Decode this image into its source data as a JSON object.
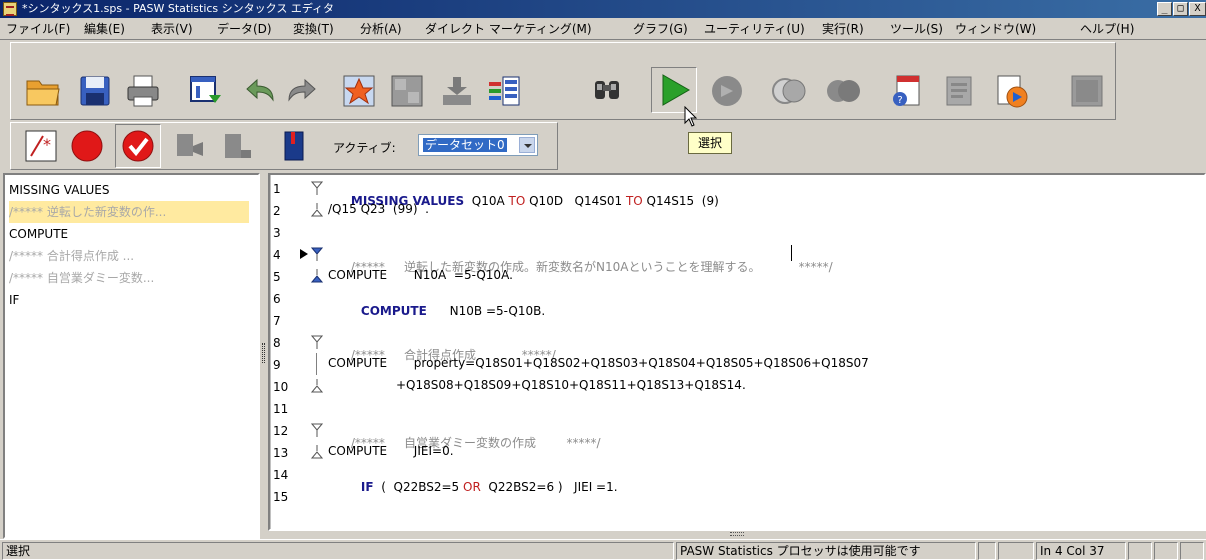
{
  "window": {
    "title": "*シンタックス1.sps - PASW Statistics シンタックス エディタ",
    "controls": [
      "_",
      "□",
      "X"
    ]
  },
  "menu": [
    "ファイル(F)",
    "編集(E)",
    "表示(V)",
    "データ(D)",
    "変換(T)",
    "分析(A)",
    "ダイレクト マーケティング(M)",
    "グラフ(G)",
    "ユーティリティ(U)",
    "実行(R)",
    "ツール(S)",
    "ウィンドウ(W)",
    "ヘルプ(H)"
  ],
  "toolbar": {
    "icons": [
      "open-folder-icon",
      "save-icon",
      "print-icon",
      "recall-dialog-icon",
      "undo-icon",
      "redo-icon",
      "go-to-case-icon",
      "go-to-variable-icon",
      "variables-icon",
      "use-variable-sets-icon",
      "find-icon",
      "run-selection-icon",
      "step-through-icon",
      "step-forward-icon",
      "continue-icon",
      "help-icon",
      "syntax-help-icon",
      "active-dataset-icon",
      "options-icon"
    ],
    "tooltip": "選択",
    "row2_icons": [
      "toggle-comment-icon",
      "breakpoint-icon",
      "clear-breakpoints-icon",
      "bookmark-icon",
      "next-bookmark-icon",
      "book-icon"
    ]
  },
  "active_dataset": {
    "label": "アクティブ:",
    "value": "データセット0"
  },
  "navigator": [
    {
      "text": "MISSING VALUES",
      "comment": false,
      "selected": false
    },
    {
      "text": "/*****   逆転した新変数の作...",
      "comment": true,
      "selected": true
    },
    {
      "text": "COMPUTE",
      "comment": false,
      "selected": false
    },
    {
      "text": "/*****   合計得点作成  ...",
      "comment": true,
      "selected": false
    },
    {
      "text": "/*****   自営業ダミー変数...",
      "comment": true,
      "selected": false
    },
    {
      "text": "IF",
      "comment": false,
      "selected": false
    }
  ],
  "editor": {
    "lines": [
      {
        "num": "1"
      },
      {
        "num": "2"
      },
      {
        "num": "3"
      },
      {
        "num": "4"
      },
      {
        "num": "5"
      },
      {
        "num": "6"
      },
      {
        "num": "7"
      },
      {
        "num": "8"
      },
      {
        "num": "9"
      },
      {
        "num": "10"
      },
      {
        "num": "11"
      },
      {
        "num": "12"
      },
      {
        "num": "13"
      },
      {
        "num": "14"
      },
      {
        "num": "15"
      }
    ],
    "code": {
      "l1_kw": "MISSING VALUES",
      "l1_a": "  Q10A ",
      "l1_to1": "TO",
      "l1_b": " Q10D   Q14S01 ",
      "l1_to2": "TO",
      "l1_c": " Q14S15  (9)",
      "l2": "/Q15 Q23  (99)  .",
      "l4_open": "/*****",
      "l4_text": "     逆転した新変数の作成。新変数名がN10Aということを理解する。",
      "l4_close": "          *****/",
      "l5": "COMPUTE       N10A  =5-Q10A.",
      "l6_kw": "COMPUTE",
      "l6_rest": "      N10B =5-Q10B.",
      "l8_open": "/*****",
      "l8_text": "     合計得点作成",
      "l8_close": "            *****/",
      "l9": "COMPUTE       property=Q18S01+Q18S02+Q18S03+Q18S04+Q18S05+Q18S06+Q18S07",
      "l10": "+Q18S08+Q18S09+Q18S10+Q18S11+Q18S13+Q18S14.",
      "l12_open": "/*****",
      "l12_text": "     自営業ダミー変数の作成",
      "l12_close": "        *****/",
      "l13": "COMPUTE       JIEI=0.",
      "l14_kw": "IF",
      "l14_a": "  (  Q22BS2=5 ",
      "l14_or": "OR",
      "l14_b": "  Q22BS2=6 )   JIEI =1."
    }
  },
  "status": {
    "left": "選択",
    "processor": "PASW Statistics プロセッサは使用可能です",
    "position": "In 4 Col 37"
  }
}
